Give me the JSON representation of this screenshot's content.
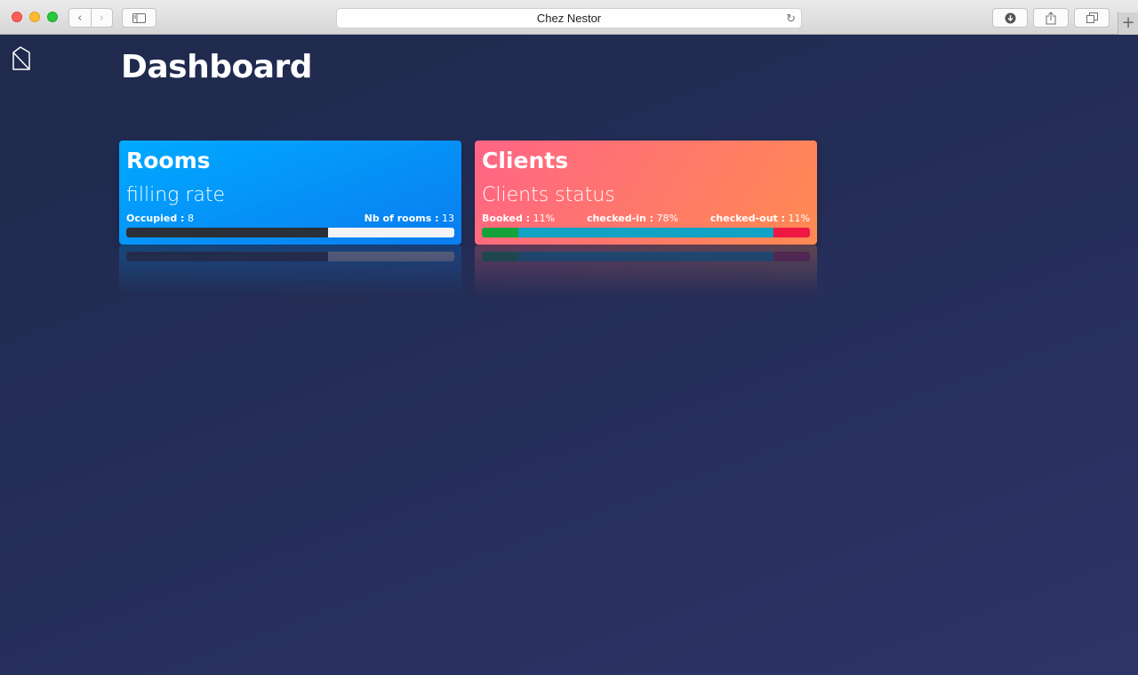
{
  "browser": {
    "title": "Chez Nestor"
  },
  "page": {
    "title": "Dashboard"
  },
  "rooms_card": {
    "title": "Rooms",
    "subtitle": "filling rate",
    "occupied_label": "Occupied :",
    "occupied_value": "8",
    "total_label": "Nb of rooms :",
    "total_value": "13",
    "fill_fraction": 0.615,
    "colors": {
      "fill": "#2b3038",
      "track": "#f4f4f6"
    }
  },
  "clients_card": {
    "title": "Clients",
    "subtitle": "Clients status",
    "booked_label": "Booked :",
    "booked_value": "11%",
    "checked_in_label": "checked-in :",
    "checked_in_value": "78%",
    "checked_out_label": "checked-out :",
    "checked_out_value": "11%",
    "segments": [
      0.11,
      0.78,
      0.11
    ],
    "colors": {
      "booked": "#16a23a",
      "checked_in": "#11a2c4",
      "checked_out": "#ee1844"
    }
  }
}
